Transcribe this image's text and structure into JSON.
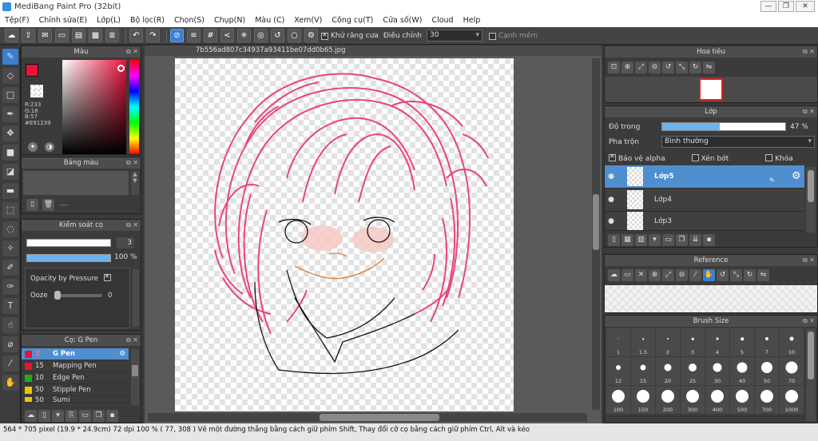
{
  "window": {
    "title": "MediBang Paint Pro (32bit)",
    "minimize": "—",
    "restore": "❐",
    "close": "✕"
  },
  "menu": [
    "Tệp(F)",
    "Chỉnh sửa(E)",
    "Lớp(L)",
    "Bộ lọc(R)",
    "Chọn(S)",
    "Chụp(N)",
    "Màu (C)",
    "Xem(V)",
    "Công cụ(T)",
    "Cửa số(W)",
    "Cloud",
    "Help"
  ],
  "toolbar": {
    "antialias_label": "Khử răng cưa",
    "adjust_label": "Điều chỉnh",
    "adjust_value": "30",
    "smooth_label": "Cạnh mềm"
  },
  "color_panel": {
    "title": "Màu",
    "rgb": [
      "R:233",
      "G:18",
      "B:57"
    ],
    "hex": "#E91239",
    "color": "#E91239"
  },
  "palette_panel": {
    "title": "Bảng màu",
    "dash": "---"
  },
  "brush_control": {
    "title": "Kiểm soát cọ",
    "size": "3",
    "opacity": "100 %",
    "opacity_frac": 1.0,
    "pressure_label": "Opacity by Pressure",
    "ooze_label": "Ooze",
    "ooze_value": "0"
  },
  "brush_list": {
    "title": "Cọ: G Pen",
    "items": [
      {
        "size": "3",
        "name": "G Pen",
        "color": "#E91239"
      },
      {
        "size": "15",
        "name": "Mapping Pen",
        "color": "#E91239"
      },
      {
        "size": "10",
        "name": "Edge Pen",
        "color": "#22aa22"
      },
      {
        "size": "50",
        "name": "Stipple Pen",
        "color": "#e6c800"
      },
      {
        "size": "50",
        "name": "Sumi",
        "color": "#e6c800"
      }
    ]
  },
  "canvas": {
    "filename": "7b556ad807c34937a93411be07dd0b65.jpg"
  },
  "navigator": {
    "title": "Hoa tiêu"
  },
  "layer_panel": {
    "title": "Lớp",
    "opacity_label": "Độ trong",
    "opacity_value": "47 %",
    "opacity_frac": 0.47,
    "blend_label": "Pha trộn",
    "blend_value": "Bình thường",
    "protect_alpha": "Bảo vệ alpha",
    "clipping": "Xén bớt",
    "lock": "Khóa",
    "layers": [
      "Lớp5",
      "Lớp4",
      "Lớp3"
    ]
  },
  "reference_panel": {
    "title": "Reference"
  },
  "brush_size_panel": {
    "title": "Brush Size",
    "sizes": [
      "1",
      "1.5",
      "2",
      "3",
      "4",
      "5",
      "7",
      "10",
      "12",
      "15",
      "20",
      "25",
      "30",
      "40",
      "50",
      "70",
      "100",
      "150",
      "200",
      "300",
      "400",
      "500",
      "700",
      "1000"
    ]
  },
  "status": {
    "text": "564 * 705 pixel   (19.9 * 24.9cm)   72 dpi   100 %   ( 77, 308 )   Vẽ một đường thẳng bằng cách giữ phím Shift, Thay đổi cỡ cọ bằng cách giữ phím Ctrl, Alt và kéo"
  }
}
